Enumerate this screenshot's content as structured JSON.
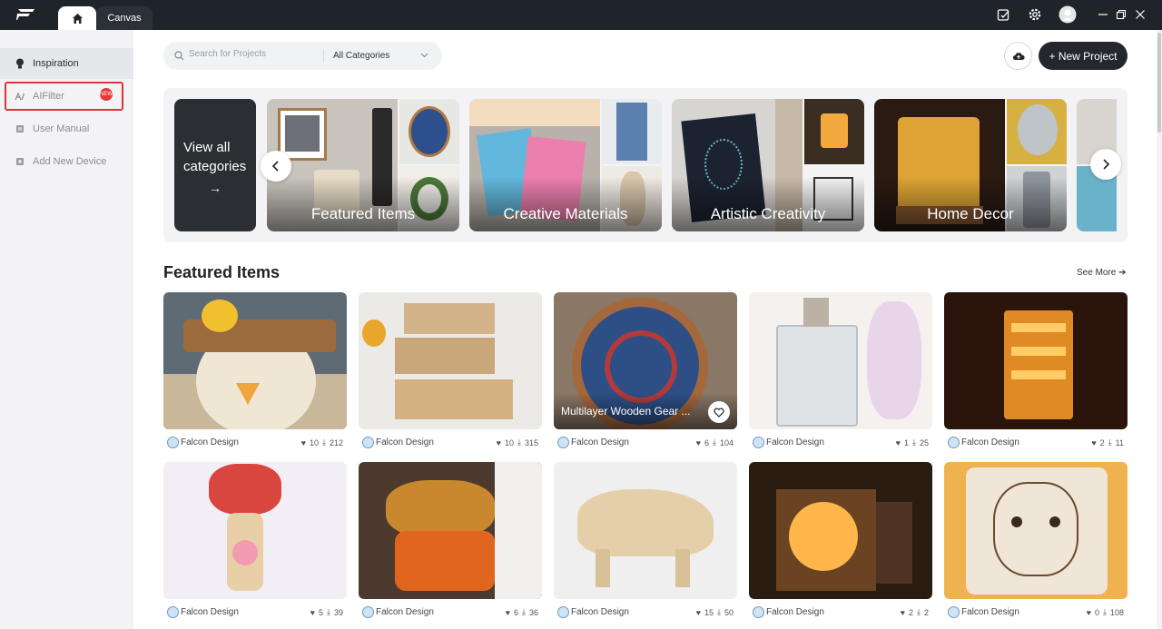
{
  "topbar": {
    "tabs": [
      {
        "label": ""
      },
      {
        "label": "Canvas"
      }
    ],
    "icons": [
      "logo-icon",
      "home-icon",
      "notes-icon",
      "gear-icon",
      "avatar",
      "minimize-icon",
      "restore-icon",
      "close-icon"
    ]
  },
  "sidebar": {
    "items": [
      {
        "label": "Inspiration",
        "icon": "bulb-icon"
      },
      {
        "label": "AIFilter",
        "icon": "ai-icon",
        "badge": "NEW"
      },
      {
        "label": "User Manual",
        "icon": "manual-icon"
      },
      {
        "label": "Add New Device",
        "icon": "add-device-icon"
      }
    ]
  },
  "search": {
    "placeholder": "Search for Projects",
    "category": "All Categories"
  },
  "actions": {
    "new_project": "+ New Project"
  },
  "categories": {
    "view_all_line1": "View all",
    "view_all_line2": "categories",
    "view_all_arrow": "→",
    "cards": [
      {
        "label": "Featured Items"
      },
      {
        "label": "Creative Materials"
      },
      {
        "label": "Artistic Creativity"
      },
      {
        "label": "Home Decor"
      }
    ]
  },
  "featured": {
    "title": "Featured Items",
    "see_more": "See More ➔",
    "items": [
      {
        "author": "Falcon Design",
        "likes": "10",
        "downloads": "212",
        "title": ""
      },
      {
        "author": "Falcon Design",
        "likes": "10",
        "downloads": "315",
        "title": ""
      },
      {
        "author": "Falcon Design",
        "likes": "6",
        "downloads": "104",
        "title": "Multilayer Wooden Gear ..."
      },
      {
        "author": "Falcon Design",
        "likes": "1",
        "downloads": "25",
        "title": ""
      },
      {
        "author": "Falcon Design",
        "likes": "2",
        "downloads": "11",
        "title": ""
      },
      {
        "author": "Falcon Design",
        "likes": "5",
        "downloads": "39",
        "title": ""
      },
      {
        "author": "Falcon Design",
        "likes": "6",
        "downloads": "36",
        "title": ""
      },
      {
        "author": "Falcon Design",
        "likes": "15",
        "downloads": "50",
        "title": ""
      },
      {
        "author": "Falcon Design",
        "likes": "2",
        "downloads": "2",
        "title": ""
      },
      {
        "author": "Falcon Design",
        "likes": "0",
        "downloads": "108",
        "title": ""
      }
    ]
  }
}
